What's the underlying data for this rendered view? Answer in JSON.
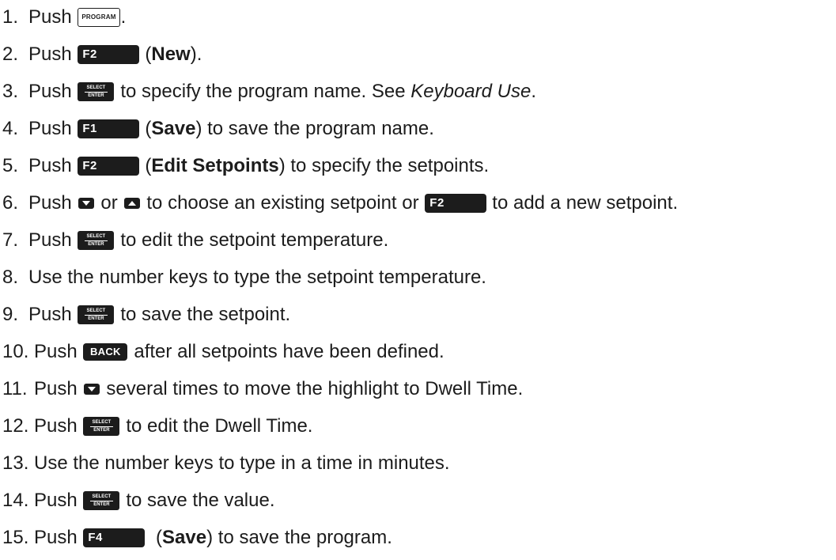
{
  "steps": [
    {
      "num": "1.",
      "parts": {
        "a": "Push ",
        "key": "PROGRAM",
        "b": "."
      }
    },
    {
      "num": "2.",
      "parts": {
        "a": "Push ",
        "key": "F2",
        "b": "(",
        "bold": "New",
        "c": ")."
      }
    },
    {
      "num": "3.",
      "parts": {
        "a": "Push ",
        "key_top": "SELECT",
        "key_bot": "ENTER",
        "b": "to specify the program name. See ",
        "italic": "Keyboard Use",
        "c": "."
      }
    },
    {
      "num": "4.",
      "parts": {
        "a": "Push ",
        "key": "F1",
        "b": "(",
        "bold": "Save",
        "c": ") to save the program name."
      }
    },
    {
      "num": "5.",
      "parts": {
        "a": "Push ",
        "key": "F2",
        "b": "(",
        "bold": "Edit Setpoints",
        "c": ") to specify the setpoints."
      }
    },
    {
      "num": "6.",
      "parts": {
        "a": "Push ",
        "b": "or ",
        "c": "to choose an existing setpoint or ",
        "key": "F2",
        "d": "to add a new setpoint."
      }
    },
    {
      "num": "7.",
      "parts": {
        "a": "Push ",
        "key_top": "SELECT",
        "key_bot": "ENTER",
        "b": "to edit the setpoint temperature."
      }
    },
    {
      "num": "8.",
      "parts": {
        "a": "Use the number keys to type the setpoint temperature."
      }
    },
    {
      "num": "9.",
      "parts": {
        "a": "Push ",
        "key_top": "SELECT",
        "key_bot": "ENTER",
        "b": "to save the setpoint."
      }
    },
    {
      "num": "10.",
      "parts": {
        "a": "Push ",
        "key": "BACK",
        "b": "after all setpoints have been defined."
      }
    },
    {
      "num": "11.",
      "parts": {
        "a": "Push ",
        "b": "several times to move the highlight to Dwell Time."
      }
    },
    {
      "num": "12.",
      "parts": {
        "a": "Push ",
        "key_top": "SELECT",
        "key_bot": "ENTER",
        "b": "to edit the Dwell Time."
      }
    },
    {
      "num": "13.",
      "parts": {
        "a": "Use the number keys to type in a time in minutes."
      }
    },
    {
      "num": "14.",
      "parts": {
        "a": "Push ",
        "key_top": "SELECT",
        "key_bot": "ENTER",
        "b": "to save the value."
      }
    },
    {
      "num": "15.",
      "parts": {
        "a": "Push ",
        "key": "F4",
        "b": " (",
        "bold": "Save",
        "c": ") to save the program."
      }
    }
  ],
  "icons": {
    "down": "down-arrow-key-icon",
    "up": "up-arrow-key-icon"
  }
}
